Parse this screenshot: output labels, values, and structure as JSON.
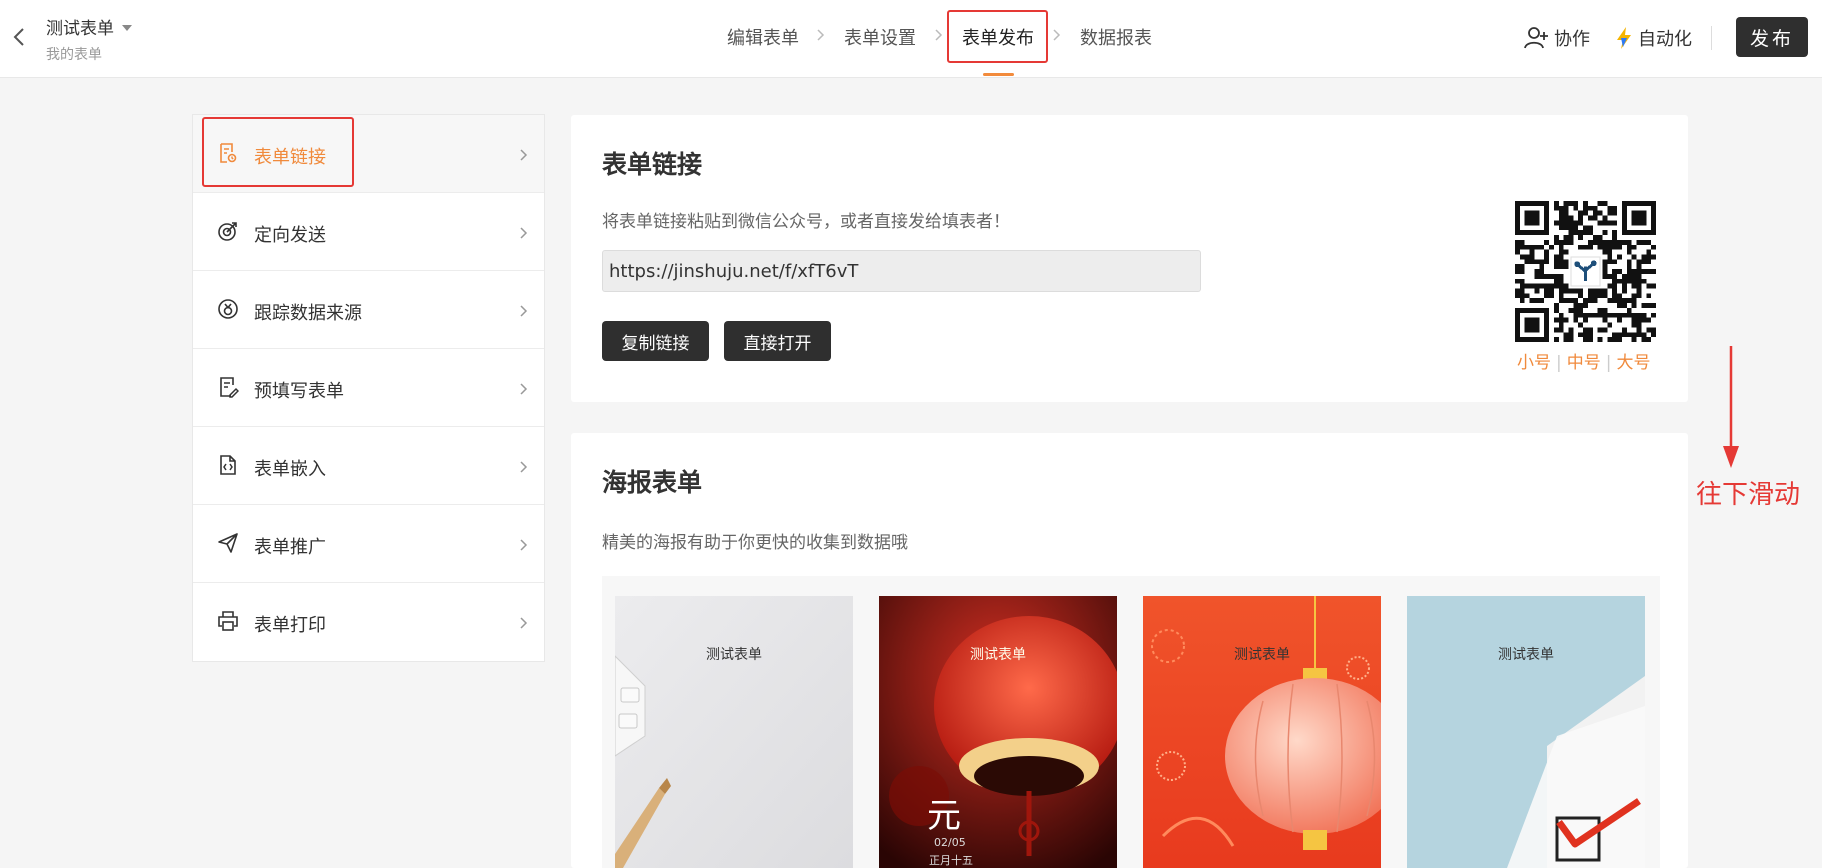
{
  "header": {
    "form_title": "测试表单",
    "form_subtitle": "我的表单",
    "steps": [
      {
        "label": "编辑表单"
      },
      {
        "label": "表单设置"
      },
      {
        "label": "表单发布"
      },
      {
        "label": "数据报表"
      }
    ],
    "active_step": "表单发布",
    "collab_label": "协作",
    "automation_label": "自动化",
    "publish_label": "发布"
  },
  "sidebar": {
    "items": [
      {
        "label": "表单链接",
        "icon": "form-link-icon"
      },
      {
        "label": "定向发送",
        "icon": "target-send-icon"
      },
      {
        "label": "跟踪数据来源",
        "icon": "track-source-icon"
      },
      {
        "label": "预填写表单",
        "icon": "prefill-form-icon"
      },
      {
        "label": "表单嵌入",
        "icon": "embed-code-icon"
      },
      {
        "label": "表单推广",
        "icon": "paper-plane-icon"
      },
      {
        "label": "表单打印",
        "icon": "printer-icon"
      }
    ],
    "selected": "表单链接"
  },
  "link_section": {
    "title": "表单链接",
    "description": "将表单链接粘贴到微信公众号，或者直接发给填表者！",
    "url": "https://jinshuju.net/f/xfT6vT",
    "copy_label": "复制链接",
    "open_label": "直接打开",
    "qr_sizes": [
      "小号",
      "中号",
      "大号"
    ]
  },
  "poster_section": {
    "title": "海报表单",
    "description": "精美的海报有助于你更快的收集到数据哦",
    "posters": [
      {
        "label": "测试表单",
        "theme": "office-desk"
      },
      {
        "label": "测试表单",
        "theme": "red-lantern-night",
        "caption_main": "元",
        "caption_date": "02/05",
        "caption_sub": "正月十五"
      },
      {
        "label": "测试表单",
        "theme": "orange-lantern"
      },
      {
        "label": "测试表单",
        "theme": "blue-checkbox"
      }
    ]
  },
  "annotation": {
    "text": "往下滑动"
  },
  "colors": {
    "accent_orange": "#f08a3c",
    "dark_button": "#2f2f2f",
    "annotation_red": "#e53935"
  }
}
